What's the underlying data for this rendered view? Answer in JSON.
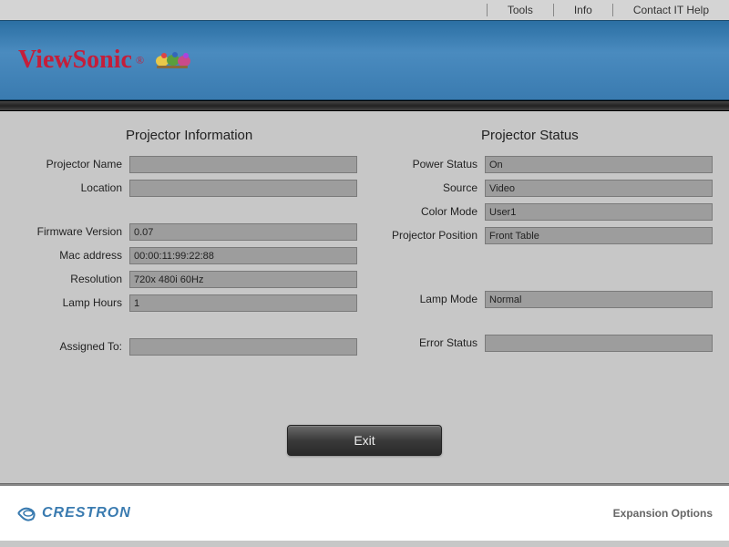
{
  "nav": {
    "tools": "Tools",
    "info": "Info",
    "contact": "Contact IT Help"
  },
  "brand": {
    "viewsonic": "ViewSonic",
    "reg": "®"
  },
  "sections": {
    "info_title": "Projector Information",
    "status_title": "Projector Status"
  },
  "info": {
    "projector_name_label": "Projector Name",
    "projector_name_value": "",
    "location_label": "Location",
    "location_value": "",
    "firmware_label": "Firmware Version",
    "firmware_value": "0.07",
    "mac_label": "Mac address",
    "mac_value": "00:00:11:99:22:88",
    "resolution_label": "Resolution",
    "resolution_value": "720x 480i 60Hz",
    "lamp_hours_label": "Lamp Hours",
    "lamp_hours_value": "1",
    "assigned_label": "Assigned To:",
    "assigned_value": ""
  },
  "status": {
    "power_label": "Power Status",
    "power_value": "On",
    "source_label": "Source",
    "source_value": "Video",
    "color_mode_label": "Color Mode",
    "color_mode_value": "User1",
    "position_label": "Projector Position",
    "position_value": "Front Table",
    "lamp_mode_label": "Lamp Mode",
    "lamp_mode_value": "Normal",
    "error_label": "Error Status",
    "error_value": ""
  },
  "exit_label": "Exit",
  "footer": {
    "crestron": "CRESTRON",
    "expansion": "Expansion Options"
  }
}
